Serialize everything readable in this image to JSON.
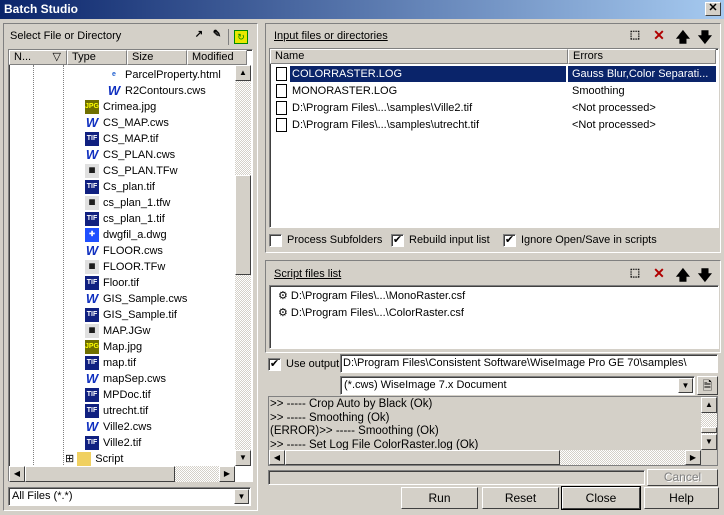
{
  "window": {
    "title": "Batch Studio",
    "close": "✕"
  },
  "left": {
    "title": "Select File or Directory",
    "columns": [
      "N...",
      "Type",
      "Size",
      "Modified"
    ],
    "tree": [
      {
        "name": "ParcelProperty.html",
        "icon": "html",
        "deep": true
      },
      {
        "name": "R2Contours.cws",
        "icon": "cws",
        "deep": true
      },
      {
        "name": "Crimea.jpg",
        "icon": "jpg"
      },
      {
        "name": "CS_MAP.cws",
        "icon": "cws"
      },
      {
        "name": "CS_MAP.tif",
        "icon": "tif"
      },
      {
        "name": "CS_PLAN.cws",
        "icon": "cws"
      },
      {
        "name": "CS_PLAN.TFw",
        "icon": "tfw"
      },
      {
        "name": "Cs_plan.tif",
        "icon": "tif"
      },
      {
        "name": "cs_plan_1.tfw",
        "icon": "tfw"
      },
      {
        "name": "cs_plan_1.tif",
        "icon": "tif"
      },
      {
        "name": "dwgfil_a.dwg",
        "icon": "dwg"
      },
      {
        "name": "FLOOR.cws",
        "icon": "cws"
      },
      {
        "name": "FLOOR.TFw",
        "icon": "tfw"
      },
      {
        "name": "Floor.tif",
        "icon": "tif"
      },
      {
        "name": "GIS_Sample.cws",
        "icon": "cws"
      },
      {
        "name": "GIS_Sample.tif",
        "icon": "tif"
      },
      {
        "name": "MAP.JGw",
        "icon": "tfw"
      },
      {
        "name": "Map.jpg",
        "icon": "jpg"
      },
      {
        "name": "map.tif",
        "icon": "tif"
      },
      {
        "name": "mapSep.cws",
        "icon": "cws"
      },
      {
        "name": "MPDoc.tif",
        "icon": "tif"
      },
      {
        "name": "utrecht.tif",
        "icon": "tif"
      },
      {
        "name": "Ville2.cws",
        "icon": "cws"
      },
      {
        "name": "Ville2.tif",
        "icon": "tif"
      },
      {
        "name": "Script",
        "icon": "folder",
        "folder": true
      }
    ],
    "filter": "All Files (*.*)"
  },
  "input": {
    "title": "Input files or directories",
    "columns": [
      "Name",
      "Errors"
    ],
    "rows": [
      {
        "name": "COLORRASTER.LOG",
        "errors": "Gauss Blur,Color Separati...",
        "selected": true
      },
      {
        "name": "MONORASTER.LOG",
        "errors": "Smoothing"
      },
      {
        "name": "D:\\Program Files\\...\\samples\\Ville2.tif",
        "errors": "<Not processed>"
      },
      {
        "name": "D:\\Program Files\\...\\samples\\utrecht.tif",
        "errors": "<Not processed>"
      }
    ]
  },
  "options": {
    "process_subfolders": "Process Subfolders",
    "rebuild": "Rebuild input list",
    "ignore": "Ignore Open/Save in scripts"
  },
  "scripts": {
    "title": "Script files list",
    "rows": [
      "D:\\Program Files\\...\\MonoRaster.csf",
      "D:\\Program Files\\...\\ColorRaster.csf"
    ]
  },
  "output": {
    "label": "Use output",
    "path": "D:\\Program Files\\Consistent Software\\WiseImage Pro GE 70\\samples\\",
    "format": "(*.cws) WiseImage 7.x Document"
  },
  "log": [
    "&gt;&gt; ----- Crop Auto by Black (Ok)",
    ">> ----- Smoothing (Ok)",
    "(ERROR)>> ----- Smoothing (Ok)",
    ">> ----- Set Log File ColorRaster.log (Ok)"
  ],
  "buttons": {
    "cancel": "Cancel",
    "run": "Run",
    "reset": "Reset",
    "close": "Close",
    "help": "Help"
  }
}
